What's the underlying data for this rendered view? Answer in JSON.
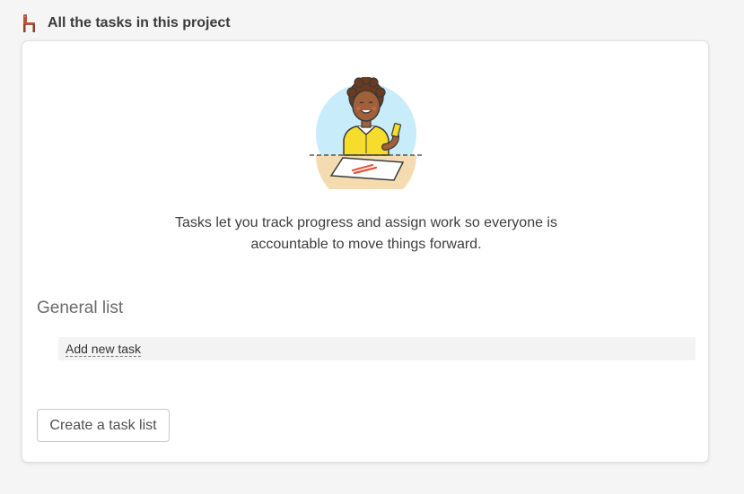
{
  "header": {
    "title": "All the tasks in this project",
    "icon": "chair-icon"
  },
  "empty_state": {
    "illustration": "person-drawing-illustration",
    "message_line1": "Tasks let you track progress and assign work so everyone is",
    "message_line2": "accountable to move things forward."
  },
  "task_list": {
    "name": "General list",
    "add_task_label": "Add new task"
  },
  "actions": {
    "create_list_label": "Create a task list"
  },
  "colors": {
    "background": "#f5f5f5",
    "card": "#ffffff",
    "illustration_circle": "#c8ecf9",
    "shirt": "#f6dd2b",
    "skin": "#a0603a",
    "chair": "#a0523a",
    "scribble": "#e5543b"
  }
}
